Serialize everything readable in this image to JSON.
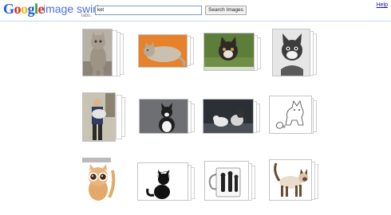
{
  "header": {
    "logo_text": "Google",
    "product_name": "image swirl",
    "labs_label": "labs.",
    "search_value": "kot",
    "search_button_label": "Search Images",
    "help_label": "Help"
  },
  "colors": {
    "google_blue": "#1f5bd1",
    "google_red": "#d62d20",
    "google_yellow": "#f2b50f",
    "google_green": "#2b9f3b",
    "link": "#1a0dab",
    "header_rule": "#c9d7f1"
  },
  "results": [
    {
      "name": "cat-sitting-upright",
      "description": "tabby cat standing on hind legs"
    },
    {
      "name": "cat-lying-orange-background",
      "description": "cat lying down on orange background"
    },
    {
      "name": "cat-with-dog",
      "description": "cat on lawn"
    },
    {
      "name": "cat-black-and-white-photo",
      "description": "monochrome cat portrait"
    },
    {
      "name": "man-holding-cat",
      "description": "man in room holding cat"
    },
    {
      "name": "black-white-cat-sitting",
      "description": "black and white cat on gray background"
    },
    {
      "name": "cats-on-car",
      "description": "two cats on dark surface"
    },
    {
      "name": "cat-line-drawing",
      "description": "sketch of cats"
    },
    {
      "name": "big-eyed-kitten-cartoon",
      "description": "cartoon kitten with large eyes"
    },
    {
      "name": "black-cat-silhouette",
      "description": "black cat silhouette illustration"
    },
    {
      "name": "cat-mug",
      "description": "white mug with cat print"
    },
    {
      "name": "siamese-cat",
      "description": "siamese cat standing"
    }
  ]
}
